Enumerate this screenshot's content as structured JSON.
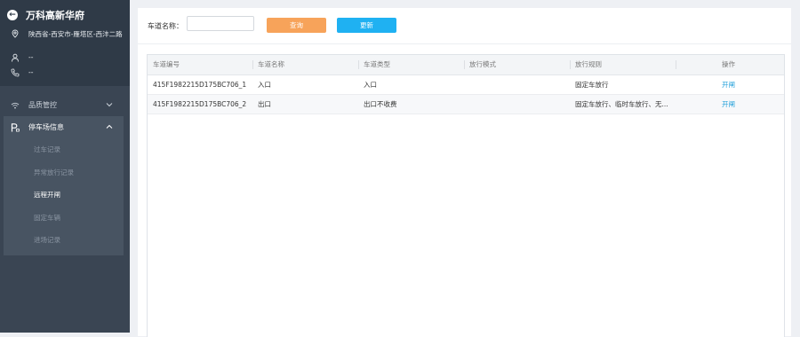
{
  "sidebar": {
    "title": "万科高新华府",
    "address": "陕西省-西安市-雁塔区-西沣二路",
    "user": "--",
    "phone": "--",
    "menu": [
      {
        "label": "品质管控",
        "icon": "wifi-icon",
        "expanded": false
      },
      {
        "label": "停车场信息",
        "icon": "parking-icon",
        "expanded": true
      }
    ],
    "submenu": [
      {
        "label": "过车记录",
        "active": false
      },
      {
        "label": "异常放行记录",
        "active": false
      },
      {
        "label": "远程开闸",
        "active": true
      },
      {
        "label": "固定车辆",
        "active": false
      },
      {
        "label": "进场记录",
        "active": false
      }
    ]
  },
  "search": {
    "label": "车道名称：",
    "value": "",
    "query_label": "查询",
    "refresh_label": "更新"
  },
  "table": {
    "columns": [
      "车道编号",
      "车道名称",
      "车道类型",
      "放行模式",
      "放行规则",
      "",
      "操作"
    ],
    "rows": [
      {
        "id": "415F1982215D175BC706_1",
        "name": "入口",
        "type": "入口",
        "mode": "",
        "rule": "固定车放行",
        "action": "开闸"
      },
      {
        "id": "415F1982215D175BC706_2",
        "name": "出口",
        "type": "出口不收费",
        "mode": "",
        "rule": "固定车放行、临时车放行、无...",
        "action": "开闸"
      }
    ]
  },
  "colors": {
    "sidebar_bg": "#3a4553",
    "query_button": "#f7a35a",
    "refresh_button": "#1fb1f2",
    "link": "#1a9cd8"
  }
}
